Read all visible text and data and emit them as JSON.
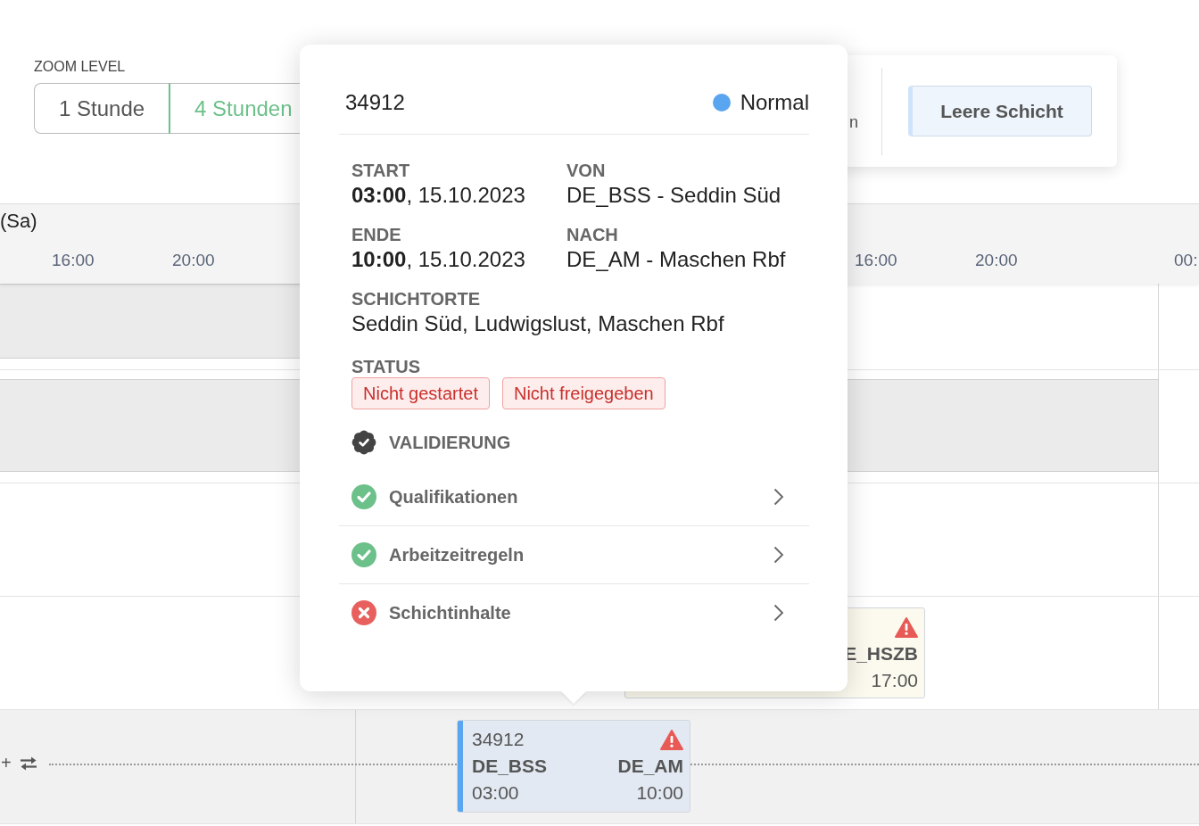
{
  "zoom_level": {
    "label": "ZOOM LEVEL",
    "options": [
      {
        "label": "1 Stunde",
        "selected": false
      },
      {
        "label": "4 Stunden",
        "selected": true
      }
    ]
  },
  "toolbar": {
    "partial_text": "n",
    "button": "Leere Schicht"
  },
  "timeline": {
    "day_label": "(Sa)",
    "hours_left": [
      "16:00",
      "20:00"
    ],
    "hours_right": [
      "16:00",
      "20:00"
    ],
    "next_day_hour": "00:",
    "row_control": {
      "plus": "+"
    },
    "shifts": [
      {
        "kind": "partial",
        "to": "E_HSZB",
        "end": "17:00",
        "warning": true
      },
      {
        "kind": "full",
        "id": "34912",
        "from": "DE_BSS",
        "to": "DE_AM",
        "start": "03:00",
        "end": "10:00",
        "color": "#5aa5f0",
        "warning": true
      }
    ]
  },
  "popover": {
    "id": "34912",
    "priority": {
      "label": "Normal",
      "color": "#5aa5f0"
    },
    "fields": [
      {
        "label": "START",
        "value": "**03:00**, 15.10.2023"
      },
      {
        "label": "VON",
        "value": "DE_BSS - Seddin Süd"
      },
      {
        "label": "ENDE",
        "value": "**10:00**, 15.10.2023"
      },
      {
        "label": "NACH",
        "value": "DE_AM - Maschen Rbf"
      }
    ],
    "locations": {
      "label": "SCHICHTORTE",
      "value": "Seddin Süd, Ludwigslust, Maschen Rbf"
    },
    "status": {
      "label": "STATUS",
      "tags": [
        "Nicht gestartet",
        "Nicht freigegeben"
      ]
    },
    "validation": {
      "title": "VALIDIERUNG",
      "items": [
        {
          "label": "Qualifikationen",
          "passed": true
        },
        {
          "label": "Arbeitzeitregeln",
          "passed": true
        },
        {
          "label": "Schichtinhalte",
          "passed": false
        }
      ]
    }
  }
}
